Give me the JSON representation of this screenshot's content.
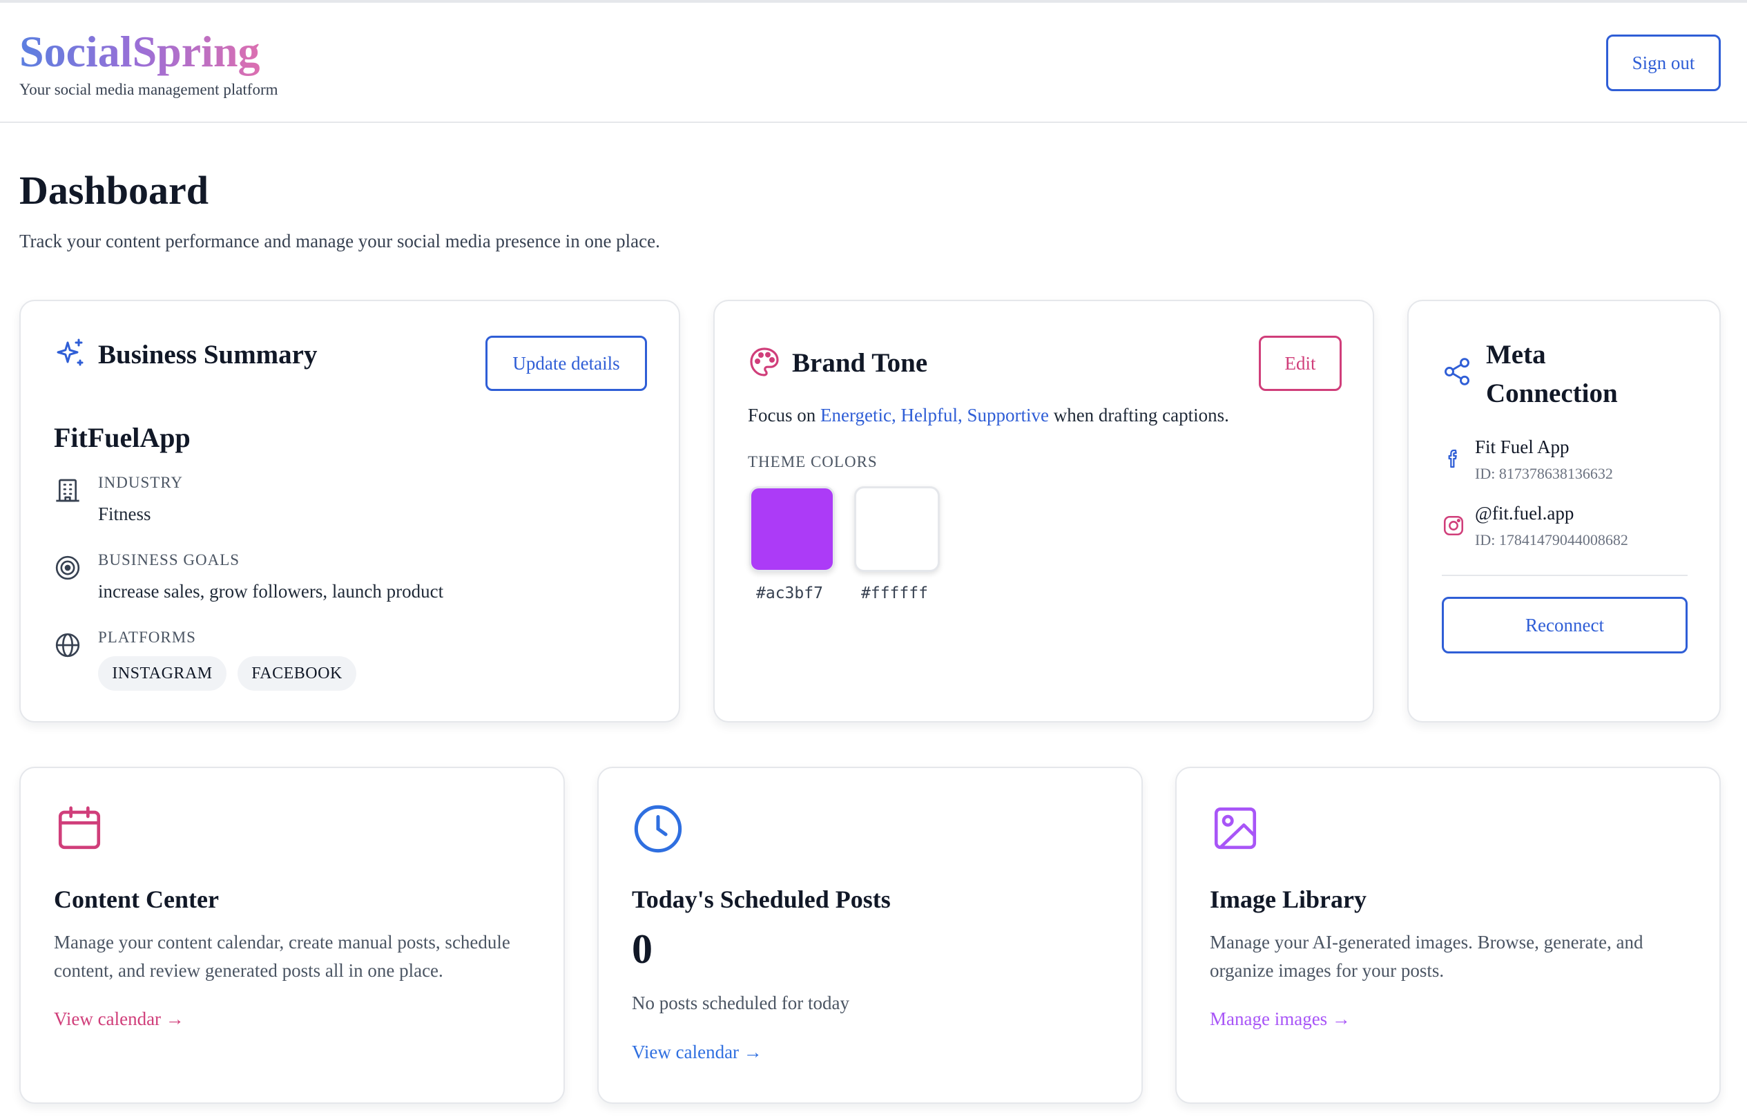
{
  "app": {
    "name": "SocialSpring",
    "tagline": "Your social media management platform",
    "signout_label": "Sign out"
  },
  "page": {
    "title": "Dashboard",
    "subtitle": "Track your content performance and manage your social media presence in one place."
  },
  "business_summary": {
    "title": "Business Summary",
    "update_label": "Update details",
    "name": "FitFuelApp",
    "industry_label": "INDUSTRY",
    "industry": "Fitness",
    "goals_label": "BUSINESS GOALS",
    "goals": "increase sales, grow followers, launch product",
    "platforms_label": "PLATFORMS",
    "platforms": [
      "INSTAGRAM",
      "FACEBOOK"
    ]
  },
  "brand_tone": {
    "title": "Brand Tone",
    "edit_label": "Edit",
    "focus_prefix": "Focus on ",
    "keywords": [
      "Energetic",
      "Helpful",
      "Supportive"
    ],
    "focus_suffix": " when drafting captions.",
    "theme_colors_label": "THEME COLORS",
    "theme_colors": [
      "#ac3bf7",
      "#ffffff"
    ]
  },
  "meta_connection": {
    "title_line1": "Meta",
    "title_line2": "Connection",
    "facebook_name": "Fit Fuel App",
    "facebook_id": "ID: 817378638136632",
    "instagram_name": "@fit.fuel.app",
    "instagram_id": "ID: 17841479044008682",
    "reconnect_label": "Reconnect"
  },
  "content_center": {
    "title": "Content Center",
    "description": "Manage your content calendar, create manual posts, schedule content, and review generated posts all in one place.",
    "link": "View calendar →"
  },
  "scheduled_posts": {
    "title": "Today's Scheduled Posts",
    "count": "0",
    "empty_text": "No posts scheduled for today",
    "link": "View calendar →"
  },
  "image_library": {
    "title": "Image Library",
    "description": "Manage your AI-generated images. Browse, generate, and organize images for your posts.",
    "link": "Manage images →"
  },
  "colors": {
    "primary_blue": "#2f5ed6",
    "pink": "#d03e7a",
    "purple": "#a855f7"
  }
}
